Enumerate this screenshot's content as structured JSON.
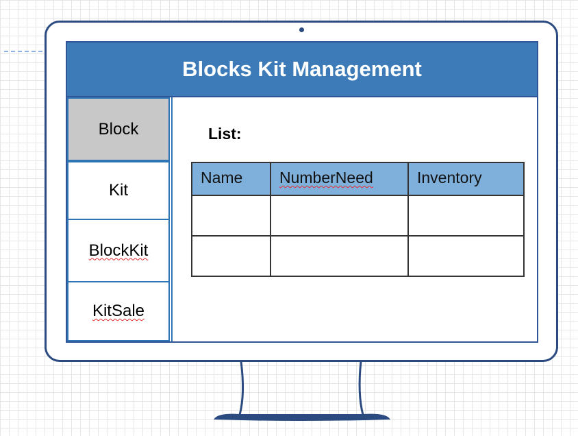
{
  "title": "Blocks Kit Management",
  "nav": {
    "items": [
      {
        "label": "Block",
        "active": true,
        "spellcheck_flag": false
      },
      {
        "label": "Kit",
        "active": false,
        "spellcheck_flag": false
      },
      {
        "label": "BlockKit",
        "active": false,
        "spellcheck_flag": true
      },
      {
        "label": "KitSale",
        "active": false,
        "spellcheck_flag": true
      }
    ]
  },
  "list": {
    "label": "List:",
    "columns": [
      "Name",
      "NumberNeed",
      "Inventory"
    ],
    "rows": [
      [
        "",
        "",
        ""
      ],
      [
        "",
        "",
        ""
      ]
    ]
  },
  "colors": {
    "title_bar": "#3d7bb8",
    "header_cell": "#7fb0db",
    "active_nav": "#c8c8c8",
    "monitor_frame": "#2b4a7f"
  }
}
